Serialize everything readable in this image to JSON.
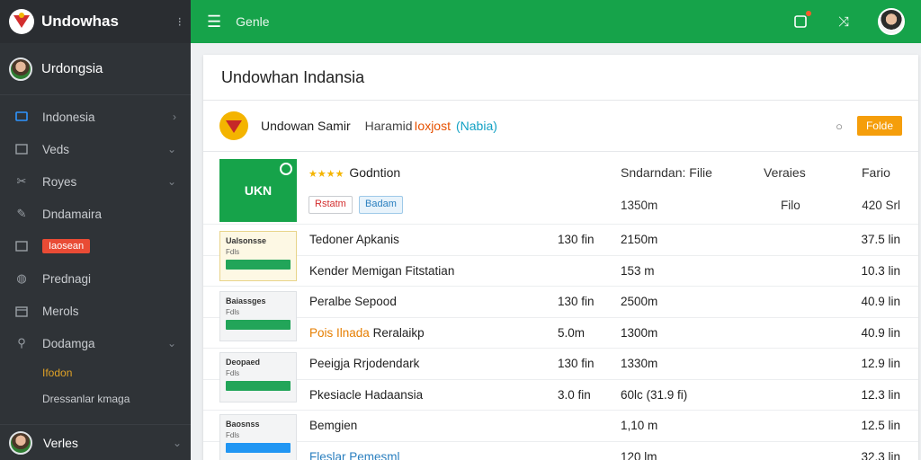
{
  "app": {
    "title": "Undowhas",
    "collapse_icon": "collapse-icon"
  },
  "user": {
    "name": "Urdongsia"
  },
  "sidebar": {
    "items": [
      {
        "label": "Indonesia",
        "icon": "monitor-icon",
        "chevron": true
      },
      {
        "label": "Veds",
        "icon": "window-icon",
        "chevron": true
      },
      {
        "label": "Royes",
        "icon": "tools-icon",
        "chevron": true
      },
      {
        "label": "Dndamaira",
        "icon": "pen-icon",
        "chevron": false
      },
      {
        "label": "Iaosean",
        "icon": "image-icon",
        "chevron": false,
        "badge": true
      },
      {
        "label": "Prednagi",
        "icon": "globe-icon",
        "chevron": false
      },
      {
        "label": "Merols",
        "icon": "calendar-icon",
        "chevron": false
      },
      {
        "label": "Dodamga",
        "icon": "pin-icon",
        "chevron": true
      }
    ],
    "sub_items": [
      "Ifodon",
      "Dressanlar kmaga"
    ],
    "footer": {
      "label": "Verles"
    }
  },
  "topbar": {
    "title": "Genle"
  },
  "panel": {
    "title": "Undowhan Indansia",
    "brand": {
      "name": "Undowan Samir",
      "sep": "Haramid",
      "tag": "Ioxjost",
      "link": "(Nabia)",
      "button": "Folde"
    }
  },
  "table": {
    "featured": {
      "thumb": "UKN",
      "stars": "★★★★",
      "title": "Godntion",
      "chip_a": "Rstatm",
      "chip_b": "Badam",
      "headers": [
        "Sndarndan: Filie",
        "Veraies",
        "Fario"
      ],
      "values": [
        "1350m",
        "Filo",
        "420 Srl"
      ]
    },
    "rows": [
      {
        "name": "Tedoner Apkanis",
        "c1": "130 fin",
        "c2": "2150m",
        "c3": "37.5 lin"
      },
      {
        "name": "Kender Memigan Fitstatian",
        "c1": "",
        "c2": "153 m",
        "c3": "10.3 lin"
      },
      {
        "name": "Peralbe Sepood",
        "c1": "130 fin",
        "c2": "2500m",
        "c3": "40.9 lin"
      },
      {
        "name_a": "Pois",
        "name_b": "Ilnada",
        "name_c": "Reralaikp",
        "c1": "5.0m",
        "c2": "1300m",
        "c3": "40.9 lin"
      },
      {
        "name": "Peeigja Rrjodendark",
        "c1": "130 fin",
        "c2": "1330m",
        "c3": "12.9 lin"
      },
      {
        "name": "Pkesiacle Hadaansia",
        "c1": "3.0 fin",
        "c2": "60lc (31.9 fi)",
        "c3": "12.3 lin"
      },
      {
        "name": "Bemgien",
        "c1": "",
        "c2": "1,10 m",
        "c3": "12.5 lin"
      },
      {
        "name": "Fleslar Pemesml",
        "c1": "",
        "c2": "120 lm",
        "c3": "32.3 lin"
      }
    ],
    "cards": [
      {
        "title": "Ualsonsse",
        "sub": "Fdls"
      },
      {
        "title": "Baiassges",
        "sub": "Fdls"
      },
      {
        "title": "Deopaed",
        "sub": "Fdls"
      },
      {
        "title": "Baosnss",
        "sub": "Fdls"
      }
    ]
  }
}
